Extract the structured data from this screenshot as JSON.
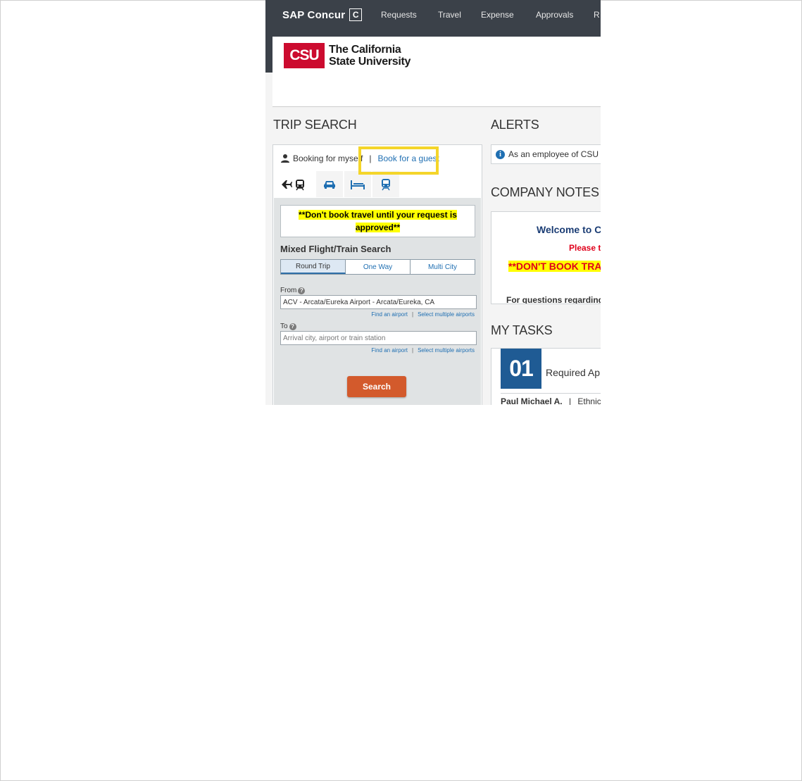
{
  "nav": {
    "brand": "SAP Concur",
    "brand_mark": "C",
    "items": [
      "Requests",
      "Travel",
      "Expense",
      "Approvals",
      "R"
    ]
  },
  "header": {
    "logo_text": "CSU",
    "university_line1": "The California",
    "university_line2": "State University"
  },
  "trip_search": {
    "title": "TRIP SEARCH",
    "booking_self": "Booking for myse f",
    "separator": "|",
    "book_guest": "Book for a guest",
    "warning_line1": "**Don't book travel until your request is",
    "warning_line2": "approved**",
    "mode_title": "Mixed Flight/Train Search",
    "trip_types": [
      "Round Trip",
      "One Way",
      "Multi City"
    ],
    "from_label": "From",
    "from_value": "ACV - Arcata/Eureka Airport - Arcata/Eureka, CA",
    "to_label": "To",
    "to_placeholder": "Arrival city, airport or train station",
    "find_airport": "Find an airport",
    "link_sep": "|",
    "select_multiple": "Select multiple airports",
    "search_button": "Search"
  },
  "alerts": {
    "title": "ALERTS",
    "text": "As an employee of CSU"
  },
  "company_notes": {
    "title": "COMPANY NOTES",
    "welcome": "Welcome to C",
    "please": "Please t",
    "dont_book": "**DON'T BOOK TRA",
    "questions": "For questions regarding"
  },
  "tasks": {
    "title": "MY TASKS",
    "count": "01",
    "label": "Required Ap",
    "row_name": "Paul Michael A.",
    "row_sep": "|",
    "row_detail": "Ethnic"
  },
  "colors": {
    "nav_bg": "#3b4149",
    "csu_red": "#cc0b2f",
    "link_blue": "#1f6fb2",
    "search_orange": "#d35a2c",
    "highlight_yellow": "#f4d52a",
    "task_blue": "#1f5b94"
  }
}
